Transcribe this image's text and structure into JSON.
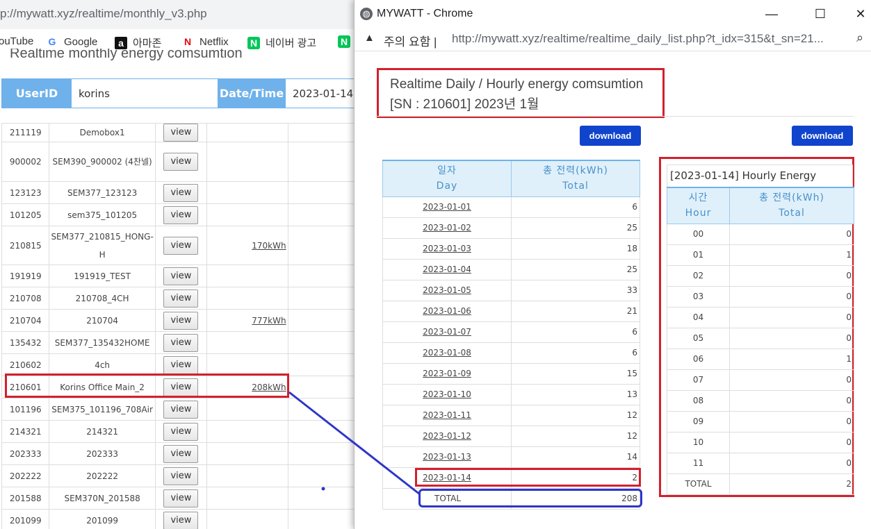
{
  "background": {
    "url_text": "p://mywatt.xyz/realtime/monthly_v3.php",
    "bookmarks": [
      {
        "icon": "youtube-icon",
        "label": "ouTube"
      },
      {
        "icon": "google-icon",
        "glyph": "G",
        "label": "Google"
      },
      {
        "icon": "amazon-icon",
        "glyph": "a",
        "label": "아마존"
      },
      {
        "icon": "netflix-icon",
        "glyph": "N",
        "label": "Netflix"
      },
      {
        "icon": "naver-icon",
        "glyph": "N",
        "label": "네이버 광고"
      },
      {
        "icon": "naver-icon",
        "glyph": "N",
        "label": ""
      }
    ],
    "heading": "Realtime monthly energy comsumtion",
    "form": {
      "user_label": "UserID",
      "user_value": "korins",
      "date_label": "Date/Time",
      "date_value": "2023-01-14"
    },
    "view_label": "view",
    "rows": [
      {
        "id": "211119",
        "name": "Demobox1",
        "usage": ""
      },
      {
        "id": "900002",
        "name": "SEM390_900002 (4찬넬)",
        "usage": ""
      },
      {
        "id": "123123",
        "name": "SEM377_123123",
        "usage": ""
      },
      {
        "id": "101205",
        "name": "sem375_101205",
        "usage": ""
      },
      {
        "id": "210815",
        "name": "SEM377_210815_HONG-H",
        "usage": "170kWh"
      },
      {
        "id": "191919",
        "name": "191919_TEST",
        "usage": ""
      },
      {
        "id": "210708",
        "name": "210708_4CH",
        "usage": ""
      },
      {
        "id": "210704",
        "name": "210704",
        "usage": "777kWh"
      },
      {
        "id": "135432",
        "name": "SEM377_135432HOME",
        "usage": ""
      },
      {
        "id": "210602",
        "name": "4ch",
        "usage": ""
      },
      {
        "id": "210601",
        "name": "Korins Office Main_2",
        "usage": "208kWh"
      },
      {
        "id": "101196",
        "name": "SEM375_101196_708Air",
        "usage": ""
      },
      {
        "id": "214321",
        "name": "214321",
        "usage": ""
      },
      {
        "id": "202333",
        "name": "202333",
        "usage": ""
      },
      {
        "id": "202222",
        "name": "202222",
        "usage": ""
      },
      {
        "id": "201588",
        "name": "SEM370N_201588",
        "usage": ""
      },
      {
        "id": "201099",
        "name": "201099",
        "usage": ""
      }
    ]
  },
  "popup": {
    "window_title": "MYWATT - Chrome",
    "controls": {
      "minimize": "—",
      "maximize": "☐",
      "close": "✕"
    },
    "warning_text": "주의 요함",
    "url": "http://mywatt.xyz/realtime/realtime_daily_list.php?t_idx=315&t_sn=21...",
    "heading_line1": "Realtime Daily / Hourly energy comsumtion",
    "heading_line2": "[SN : 210601] 2023년 1월",
    "download_label": "download",
    "day_table": {
      "col1_ko": "일자",
      "col1_en": "Day",
      "col2_ko": "총 전력(kWh)",
      "col2_en": "Total",
      "rows": [
        {
          "day": "2023-01-01",
          "total": "6"
        },
        {
          "day": "2023-01-02",
          "total": "25"
        },
        {
          "day": "2023-01-03",
          "total": "18"
        },
        {
          "day": "2023-01-04",
          "total": "25"
        },
        {
          "day": "2023-01-05",
          "total": "33"
        },
        {
          "day": "2023-01-06",
          "total": "21"
        },
        {
          "day": "2023-01-07",
          "total": "6"
        },
        {
          "day": "2023-01-08",
          "total": "6"
        },
        {
          "day": "2023-01-09",
          "total": "15"
        },
        {
          "day": "2023-01-10",
          "total": "13"
        },
        {
          "day": "2023-01-11",
          "total": "12"
        },
        {
          "day": "2023-01-12",
          "total": "12"
        },
        {
          "day": "2023-01-13",
          "total": "14"
        },
        {
          "day": "2023-01-14",
          "total": "2"
        }
      ],
      "total_label": "TOTAL",
      "total_value": "208"
    },
    "hour_table": {
      "title": "[2023-01-14] Hourly Energy",
      "col1_ko": "시간",
      "col1_en": "Hour",
      "col2_ko": "총 전력(kWh)",
      "col2_en": "Total",
      "rows": [
        {
          "hour": "00",
          "total": "0"
        },
        {
          "hour": "01",
          "total": "1"
        },
        {
          "hour": "02",
          "total": "0"
        },
        {
          "hour": "03",
          "total": "0"
        },
        {
          "hour": "04",
          "total": "0"
        },
        {
          "hour": "05",
          "total": "0"
        },
        {
          "hour": "06",
          "total": "1"
        },
        {
          "hour": "07",
          "total": "0"
        },
        {
          "hour": "08",
          "total": "0"
        },
        {
          "hour": "09",
          "total": "0"
        },
        {
          "hour": "10",
          "total": "0"
        },
        {
          "hour": "11",
          "total": "0"
        }
      ],
      "total_label": "TOTAL",
      "total_value": "2"
    }
  },
  "colors": {
    "highlight_red": "#d3202c",
    "highlight_blue": "#2e35c9",
    "header_blue": "#6fb1ea",
    "download_blue": "#1144cc"
  }
}
